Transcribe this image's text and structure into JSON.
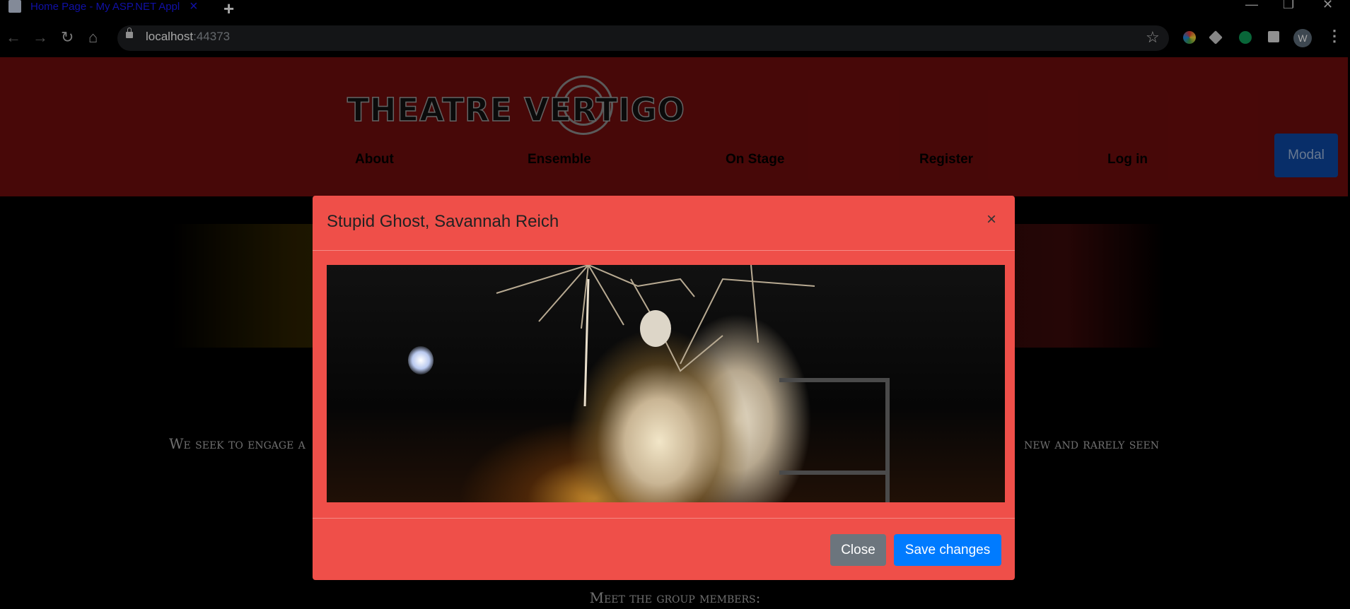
{
  "browser": {
    "tab_title": "Home Page - My ASP.NET Application",
    "tab_close": "×",
    "new_tab": "+",
    "url_host": "localhost",
    "url_port": ":44373",
    "avatar_letter": "W",
    "window_controls": [
      "—",
      "❐",
      "✕"
    ],
    "nav_icons": [
      "back-icon",
      "forward-icon",
      "reload-icon",
      "home-icon"
    ],
    "extensions": [
      "color-extension-icon",
      "dropbox-icon",
      "green-circle-extension-icon",
      "puzzle-extensions-icon"
    ]
  },
  "site": {
    "logo_text": "THEATRE VERTIGO",
    "nav": [
      "About",
      "Ensemble",
      "On Stage",
      "Register",
      "Log in"
    ],
    "modal_button": "Modal",
    "mission_left": "We seek to engage a",
    "mission_right": "new and rarely seen",
    "meet": "Meet the group members:"
  },
  "modal": {
    "title": "Stupid Ghost, Savannah Reich",
    "close_x": "×",
    "image_alt": "Stage photo of two veiled performers holding broken umbrellas",
    "close_label": "Close",
    "save_label": "Save changes"
  },
  "colors": {
    "header_bg": "#6e0d0d",
    "modal_bg": "#ef4f49",
    "primary": "#007bff",
    "secondary": "#6c757d",
    "modal_trigger": "#0d47a1"
  }
}
